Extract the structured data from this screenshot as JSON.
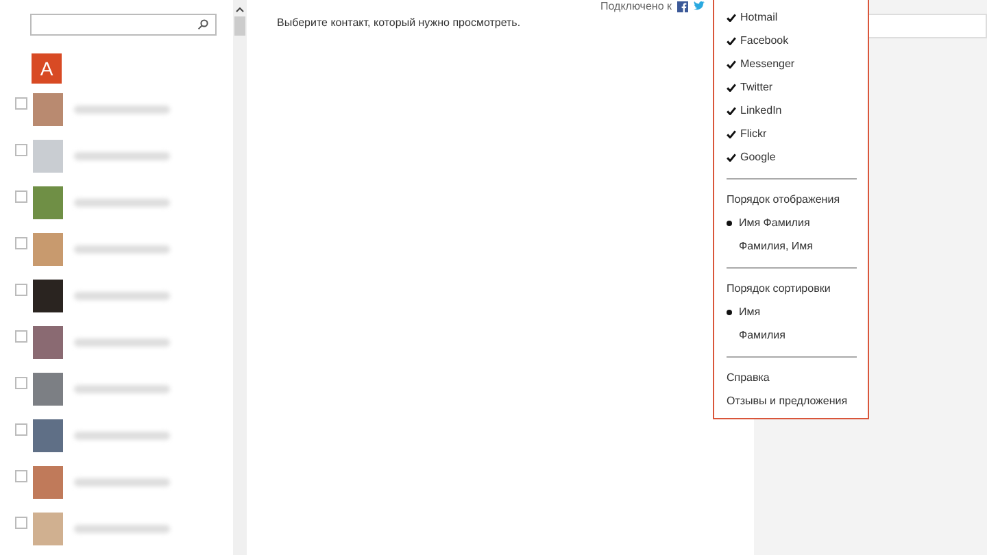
{
  "sidebar": {
    "index_letter": "А",
    "contacts": [
      {
        "checked": false
      },
      {
        "checked": false
      },
      {
        "checked": false
      },
      {
        "checked": false
      },
      {
        "checked": false
      },
      {
        "checked": false
      },
      {
        "checked": false
      },
      {
        "checked": false
      },
      {
        "checked": false
      },
      {
        "checked": false
      }
    ]
  },
  "header": {
    "connected_label": "Подключено к"
  },
  "main": {
    "hint": "Выберите контакт, который нужно просмотреть."
  },
  "menu": {
    "networks": [
      {
        "label": "Hotmail",
        "checked": true
      },
      {
        "label": "Facebook",
        "checked": true
      },
      {
        "label": "Messenger",
        "checked": true
      },
      {
        "label": "Twitter",
        "checked": true
      },
      {
        "label": "LinkedIn",
        "checked": true
      },
      {
        "label": "Flickr",
        "checked": true
      },
      {
        "label": "Google",
        "checked": true
      }
    ],
    "display_order": {
      "title": "Порядок отображения",
      "options": [
        {
          "label": "Имя Фамилия",
          "selected": true
        },
        {
          "label": "Фамилия, Имя",
          "selected": false
        }
      ]
    },
    "sort_order": {
      "title": "Порядок сортировки",
      "options": [
        {
          "label": "Имя",
          "selected": true
        },
        {
          "label": "Фамилия",
          "selected": false
        }
      ]
    },
    "links": [
      "Справка",
      "Отзывы и предложения"
    ]
  }
}
